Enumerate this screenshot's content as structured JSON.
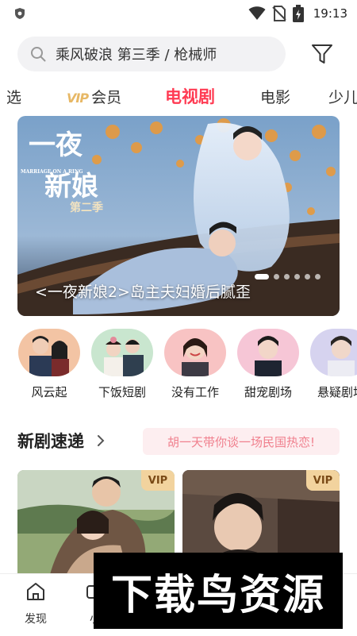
{
  "status_bar": {
    "time": "19:13",
    "icons": [
      "shield-icon",
      "wifi-icon",
      "no-sim-icon",
      "battery-charging-icon"
    ]
  },
  "search": {
    "text": "乘风破浪 第三季 / 枪械师",
    "icon": "search-icon",
    "filter_icon": "filter-icon"
  },
  "tabs": [
    {
      "label": "选",
      "active": false
    },
    {
      "label": "会员",
      "logo": "vip",
      "active": false
    },
    {
      "label": "电视剧",
      "active": true
    },
    {
      "label": "电影",
      "active": false
    },
    {
      "label": "少儿",
      "active": false
    }
  ],
  "banner": {
    "caption": "<一夜新娘2>岛主夫妇婚后腻歪",
    "title_art": "一夜新娘",
    "season_art": "第二季",
    "subtitle_art": "MARRIAGE ON A RING",
    "dots_total": 6,
    "dots_active": 0
  },
  "categories": [
    {
      "label": "风云起"
    },
    {
      "label": "下饭短剧"
    },
    {
      "label": "没有工作"
    },
    {
      "label": "甜宠剧场"
    },
    {
      "label": "悬疑剧场"
    }
  ],
  "new_section": {
    "title": "新剧速递",
    "promo": "胡一天带你谈一场民国热恋!"
  },
  "cards": [
    {
      "badge": "VIP"
    },
    {
      "badge": "VIP"
    }
  ],
  "bottom_nav": [
    {
      "label": "发现",
      "icon": "home-icon"
    },
    {
      "label": "小",
      "icon": "video-icon"
    }
  ],
  "watermark": {
    "text": "下载鸟资源"
  },
  "colors": {
    "accent": "#ff3b53",
    "vip_gold": "#e7b866",
    "promo_bg": "#fdeef0"
  }
}
